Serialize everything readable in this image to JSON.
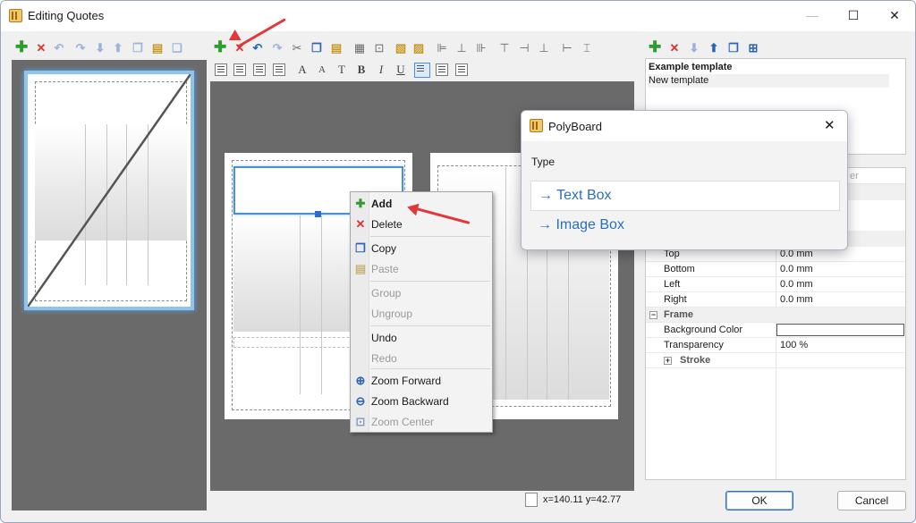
{
  "window": {
    "title": "Editing Quotes",
    "minimize_glyph": "—",
    "maximize_glyph": "☐",
    "close_glyph": "✕"
  },
  "context_menu": {
    "items": [
      {
        "label": "Add",
        "icon": "add-icon",
        "enabled": true,
        "bold": true
      },
      {
        "label": "Delete",
        "icon": "delete-icon",
        "enabled": true
      },
      {
        "label": "Copy",
        "icon": "copy-icon",
        "enabled": true
      },
      {
        "label": "Paste",
        "icon": "paste-icon",
        "enabled": false
      },
      {
        "label": "Group",
        "icon": "",
        "enabled": false
      },
      {
        "label": "Ungroup",
        "icon": "",
        "enabled": false
      },
      {
        "label": "Undo",
        "icon": "",
        "enabled": true
      },
      {
        "label": "Redo",
        "icon": "",
        "enabled": false
      },
      {
        "label": "Zoom Forward",
        "icon": "zoom-in-icon",
        "enabled": true
      },
      {
        "label": "Zoom Backward",
        "icon": "zoom-out-icon",
        "enabled": true
      },
      {
        "label": "Zoom Center",
        "icon": "zoom-center-icon",
        "enabled": false
      }
    ]
  },
  "templates": {
    "items": [
      "Example template",
      "New template"
    ],
    "selected": "Example template"
  },
  "properties": {
    "header_partial": "er",
    "rows": [
      {
        "key": "Top",
        "value": "0.0 mm",
        "type": "prop"
      },
      {
        "key": "Bottom",
        "value": "0.0 mm",
        "type": "prop"
      },
      {
        "key": "Left",
        "value": "0.0 mm",
        "type": "prop"
      },
      {
        "key": "Right",
        "value": "0.0 mm",
        "type": "prop"
      },
      {
        "key": "Frame",
        "value": "",
        "type": "section",
        "expander": "−"
      },
      {
        "key": "Background Color",
        "value": "",
        "type": "color"
      },
      {
        "key": "Transparency",
        "value": "100 %",
        "type": "prop"
      },
      {
        "key": "Stroke",
        "value": "",
        "type": "subsection",
        "expander": "+"
      }
    ]
  },
  "popup": {
    "title": "PolyBoard",
    "close_glyph": "✕",
    "type_label": "Type",
    "options": [
      {
        "label": "Text Box",
        "arrow": "→"
      },
      {
        "label": "Image Box",
        "arrow": "→"
      }
    ]
  },
  "status": {
    "coordinates": "x=140.11 y=42.77"
  },
  "buttons": {
    "ok": "OK",
    "cancel": "Cancel"
  },
  "colors": {
    "annotation_arrow": "#e2373b",
    "link_blue": "#2a6fbe",
    "selection_blue": "#4a90d9"
  }
}
